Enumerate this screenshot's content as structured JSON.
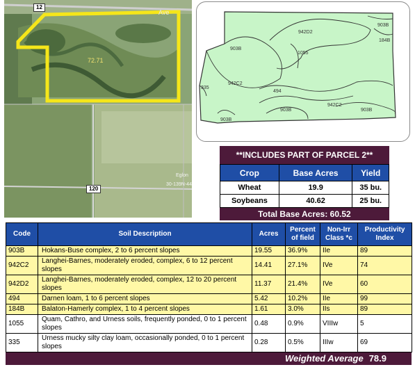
{
  "aerial_map": {
    "road_top": "12",
    "road_bottom": "120",
    "street_label": "Ave",
    "acres_label": "72.71",
    "town_label": "Eglon",
    "coords_label": "30-139N-44"
  },
  "soil_map": {
    "labels": [
      "942D2",
      "903B",
      "184B",
      "903B",
      "1055",
      "335",
      "942C2",
      "494",
      "903B",
      "942C2",
      "903B",
      "903B"
    ]
  },
  "crop_table": {
    "title": "**INCLUDES PART OF PARCEL 2**",
    "headers": [
      "Crop",
      "Base Acres",
      "Yield"
    ],
    "rows": [
      [
        "Wheat",
        "19.9",
        "35 bu."
      ],
      [
        "Soybeans",
        "40.62",
        "25 bu."
      ]
    ],
    "total": "Total Base Acres:  60.52"
  },
  "soil_table": {
    "headers": {
      "code": "Code",
      "description": "Soil Description",
      "acres": "Acres",
      "percent_line1": "Percent",
      "percent_line2": "of field",
      "class_line1": "Non-Irr",
      "class_line2": "Class *c",
      "pi_line1": "Productivity",
      "pi_line2": "Index"
    },
    "rows": [
      [
        "903B",
        "Hokans-Buse complex, 2 to 6 percent slopes",
        "19.55",
        "36.9%",
        "IIe",
        "89"
      ],
      [
        "942C2",
        "Langhei-Barnes, moderately eroded, complex, 6 to 12 percent slopes",
        "14.41",
        "27.1%",
        "IVe",
        "74"
      ],
      [
        "942D2",
        "Langhei-Barnes, moderately eroded, complex, 12 to 20 percent slopes",
        "11.37",
        "21.4%",
        "IVe",
        "60"
      ],
      [
        "494",
        "Darnen loam, 1 to 6 percent slopes",
        "5.42",
        "10.2%",
        "IIe",
        "99"
      ],
      [
        "184B",
        "Balaton-Hamerly complex, 1 to 4 percent slopes",
        "1.61",
        "3.0%",
        "IIs",
        "89"
      ],
      [
        "1055",
        "Quam, Cathro, and Urness soils, frequently ponded, 0 to 1 percent slopes",
        "0.48",
        "0.9%",
        "VIIIw",
        "5"
      ],
      [
        "335",
        "Urness mucky silty clay loam, occasionally ponded, 0 to 1 percent slopes",
        "0.28",
        "0.5%",
        "IIIw",
        "69"
      ]
    ],
    "weighted_average_label": "Weighted Average",
    "weighted_average_value": "78.9"
  },
  "colors": {
    "header_blue": "#1f4ea6",
    "maroon": "#4d1a3a",
    "highlight_yellow": "#fff8a6",
    "soil_green": "#c8f5c8",
    "boundary_yellow": "#f5e61a"
  }
}
